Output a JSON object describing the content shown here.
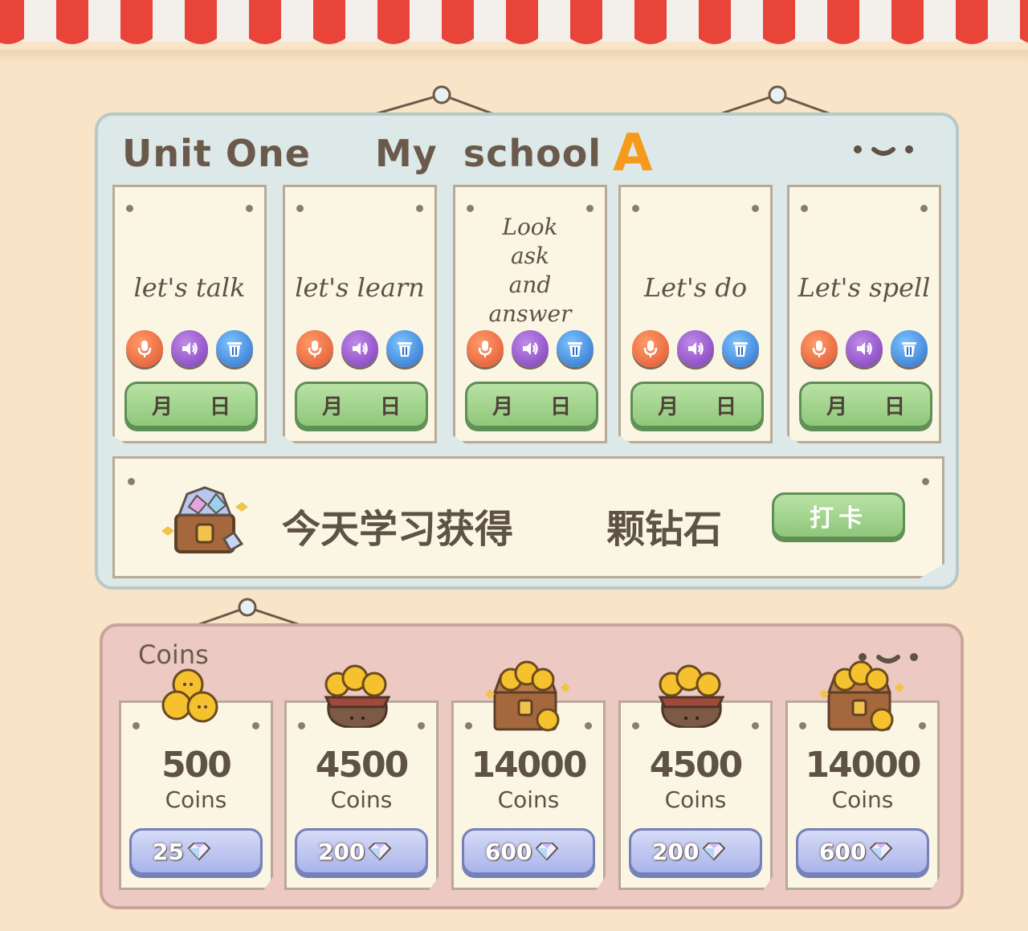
{
  "unit_title": {
    "unit": "Unit One",
    "topic_1": "My",
    "topic_2": "school",
    "letter": "A"
  },
  "lessons": [
    {
      "label": "let's talk",
      "month": "月",
      "day": "日"
    },
    {
      "label": "let's learn",
      "month": "月",
      "day": "日"
    },
    {
      "label": "Look\nask\nand\nanswer",
      "month": "月",
      "day": "日"
    },
    {
      "label": "Let's do",
      "month": "月",
      "day": "日"
    },
    {
      "label": "Let's spell",
      "month": "月",
      "day": "日"
    }
  ],
  "lesson_icons": [
    "microphone-icon",
    "speaker-icon",
    "trash-icon"
  ],
  "checkin": {
    "today_text": "今天学习获得",
    "diamond_text": "颗钻石",
    "button_label": "打卡"
  },
  "coins": {
    "title": "Coins",
    "items": [
      {
        "amount": "500",
        "unit": "Coins",
        "price": "25",
        "art": "coin-stack-icon"
      },
      {
        "amount": "4500",
        "unit": "Coins",
        "price": "200",
        "art": "coin-bag-icon"
      },
      {
        "amount": "14000",
        "unit": "Coins",
        "price": "600",
        "art": "treasure-chest-icon"
      },
      {
        "amount": "4500",
        "unit": "Coins",
        "price": "200",
        "art": "coin-bag-icon"
      },
      {
        "amount": "14000",
        "unit": "Coins",
        "price": "600",
        "art": "treasure-chest-icon"
      }
    ]
  },
  "colors": {
    "background": "#f9e4c8",
    "awning_red": "#e8443a",
    "top_panel": "#dde9e8",
    "coins_panel": "#ecc9c3",
    "green_button": "#8fc77b",
    "blue_button": "#aab4ea",
    "accent_orange": "#f59a1b"
  }
}
